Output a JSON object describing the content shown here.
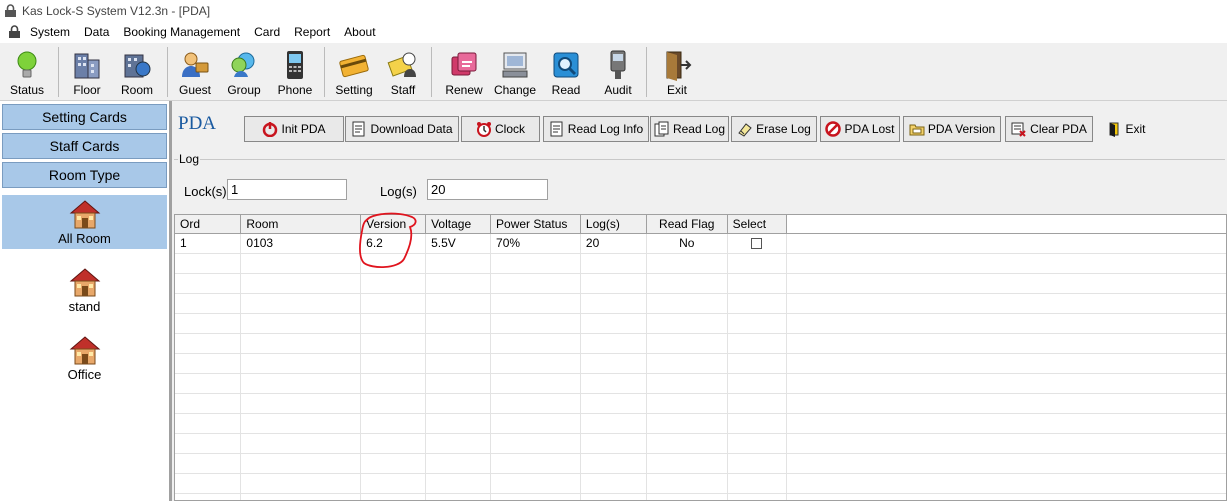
{
  "window": {
    "title": "Kas Lock-S System V12.3n - [PDA]"
  },
  "menu": [
    "System",
    "Data",
    "Booking Management",
    "Card",
    "Report",
    "About"
  ],
  "toolbar": [
    {
      "label": "Status",
      "icon": "bulb-icon"
    },
    {
      "label": "Floor",
      "icon": "building-icon"
    },
    {
      "label": "Room",
      "icon": "rooms-icon"
    },
    {
      "label": "Guest",
      "icon": "guest-icon"
    },
    {
      "label": "Group",
      "icon": "group-icon"
    },
    {
      "label": "Phone",
      "icon": "phone-icon"
    },
    {
      "label": "Setting",
      "icon": "setting-card-icon"
    },
    {
      "label": "Staff",
      "icon": "staff-card-icon"
    },
    {
      "label": "Renew",
      "icon": "renew-icon"
    },
    {
      "label": "Change",
      "icon": "change-icon"
    },
    {
      "label": "Read",
      "icon": "read-icon"
    },
    {
      "label": "Audit",
      "icon": "audit-icon"
    },
    {
      "label": "Exit",
      "icon": "exit-door-icon"
    }
  ],
  "sidebar": {
    "buttons": [
      "Setting Cards",
      "Staff Cards",
      "Room Type"
    ],
    "rooms": [
      "All Room",
      "stand",
      "Office"
    ],
    "selected": "All Room"
  },
  "pda": {
    "label": "PDA",
    "buttons": [
      "Init PDA",
      "Download Data",
      "Clock",
      "Read Log Info",
      "Read Log",
      "Erase Log",
      "PDA Lost",
      "PDA Version",
      "Clear PDA",
      "Exit"
    ]
  },
  "log": {
    "group_label": "Log",
    "lock_label": "Lock(s)",
    "lock_value": "1",
    "logs_label": "Log(s)",
    "logs_value": "20"
  },
  "table": {
    "columns": [
      "Ord",
      "Room",
      "Version",
      "Voltage",
      "Power Status",
      "Log(s)",
      "Read Flag",
      "Select"
    ],
    "rows": [
      {
        "ord": "1",
        "room": "0103",
        "version": "6.2",
        "voltage": "5.5V",
        "power": "70%",
        "logs": "20",
        "read_flag": "No",
        "select": false
      }
    ]
  },
  "annotation": {
    "color": "#e0141e",
    "target": "Version"
  }
}
